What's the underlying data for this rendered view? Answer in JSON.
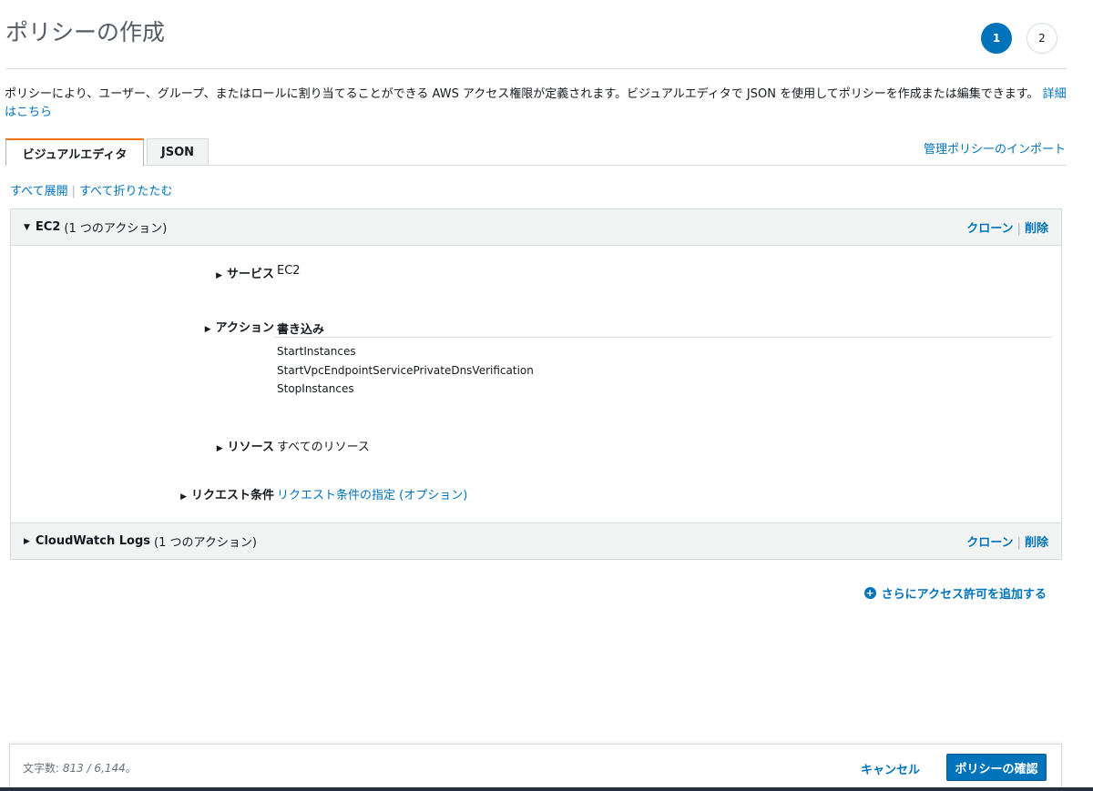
{
  "page": {
    "title": "ポリシーの作成",
    "steps": [
      "1",
      "2"
    ],
    "description": "ポリシーにより、ユーザー、グループ、またはロールに割り当てることができる AWS アクセス権限が定義されます。ビジュアルエディタで JSON を使用してポリシーを作成または編集できます。",
    "details_link": "詳細はこちら"
  },
  "tabs": [
    {
      "label": "ビジュアルエディタ",
      "active": true
    },
    {
      "label": "JSON",
      "active": false
    }
  ],
  "import_link": "管理ポリシーのインポート",
  "expand_all": "すべて展開",
  "collapse_all": "すべて折りたたむ",
  "services": [
    {
      "name": "EC2",
      "count": "(1 つのアクション)",
      "expanded": true,
      "clone": "クローン",
      "delete": "削除",
      "rows": {
        "service_label": "サービス",
        "service_value": "EC2",
        "action_label": "アクション",
        "action_group": "書き込み",
        "actions": [
          "StartInstances",
          "StartVpcEndpointServicePrivateDnsVerification",
          "StopInstances"
        ],
        "resource_label": "リソース",
        "resource_value": "すべてのリソース",
        "condition_label": "リクエスト条件",
        "condition_link": "リクエスト条件の指定 (オプション)"
      }
    },
    {
      "name": "CloudWatch Logs",
      "count": "(1 つのアクション)",
      "expanded": false,
      "clone": "クローン",
      "delete": "削除"
    }
  ],
  "add_permission": "さらにアクセス許可を追加する",
  "footer": {
    "count_label": "文字数: ",
    "count_value": "813 / 6,144",
    "count_suffix": "。",
    "cancel": "キャンセル",
    "confirm": "ポリシーの確認"
  },
  "colors": {
    "accent": "#0073bb",
    "tab_active_border": "#ec7211",
    "panel_header_bg": "#f2f3f3"
  }
}
